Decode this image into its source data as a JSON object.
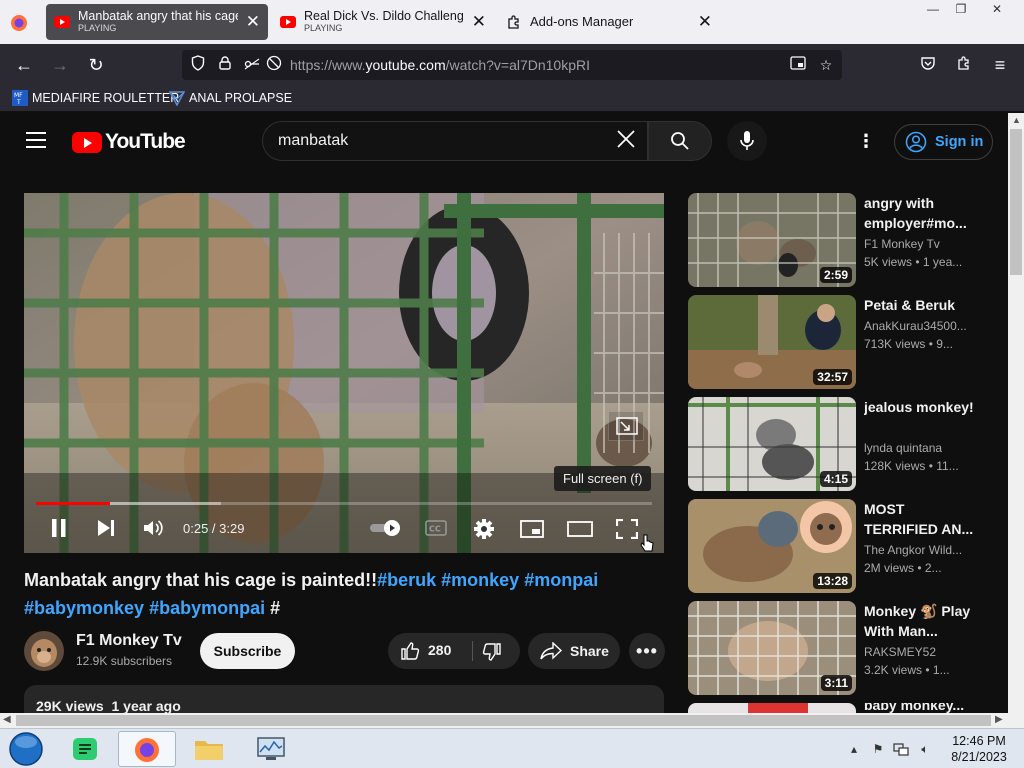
{
  "browser": {
    "tabs": [
      {
        "title": "Manbatak angry that his cage is painted!!",
        "sub": "PLAYING",
        "active": true
      },
      {
        "title": "Real Dick Vs. Dildo Challenge - Y",
        "sub": "PLAYING",
        "active": false
      },
      {
        "title": "Add-ons Manager",
        "sub": "",
        "active": false
      }
    ],
    "url_prefix": "https://www.",
    "url_domain": "youtube.com",
    "url_path": "/watch?v=al7Dn10kpRI",
    "bookmarks": [
      "MEDIAFIRE ROULETTER",
      "ANAL PROLAPSE"
    ],
    "window_controls": {
      "minimize": "—",
      "restore": "❐",
      "close": "✕"
    }
  },
  "youtube": {
    "logo_text": "YouTube",
    "search_query": "manbatak",
    "sign_in": "Sign in"
  },
  "player": {
    "current_time": "0:25",
    "duration": "3:29",
    "time_sep": " / ",
    "progress_fraction": 0.12,
    "buffered_fraction": 0.3,
    "tooltip": "Full screen (f)"
  },
  "video": {
    "title_main": "Manbatak angry that his cage is painted!!",
    "tags": [
      "#beruk",
      "#monkey",
      "#monpai",
      "#babymonkey",
      "#babymonpai",
      "#"
    ],
    "channel": "F1 Monkey Tv",
    "subscribers": "12.9K subscribers",
    "subscribe_label": "Subscribe",
    "likes": "280",
    "share_label": "Share",
    "views": "29K views",
    "age": "1 year ago"
  },
  "recommendations": [
    {
      "title": "angry with employer#mo...",
      "channel": "F1 Monkey Tv",
      "meta": "5K views • 1 yea...",
      "duration": "2:59"
    },
    {
      "title": "Petai & Beruk",
      "channel": "AnakKurau34500...",
      "meta": "713K views • 9...",
      "duration": "32:57"
    },
    {
      "title": "jealous monkey!",
      "channel": "lynda quintana",
      "meta": "128K views • 11...",
      "duration": "4:15"
    },
    {
      "title": "MOST TERRIFIED AN...",
      "channel": "The Angkor Wild...",
      "meta": "2M views • 2...",
      "duration": "13:28"
    },
    {
      "title": "Monkey 🐒 Play With Man...",
      "channel": "RAKSMEY52",
      "meta": "3.2K views • 1...",
      "duration": "3:11"
    },
    {
      "title": "baby monkey...",
      "channel": "",
      "meta": "",
      "duration": ""
    }
  ],
  "taskbar": {
    "time": "12:46 PM",
    "date": "8/21/2023"
  },
  "colors": {
    "accent_blue": "#3ea6ff",
    "yt_red": "#ff0000",
    "background": "#0f0f0f"
  }
}
